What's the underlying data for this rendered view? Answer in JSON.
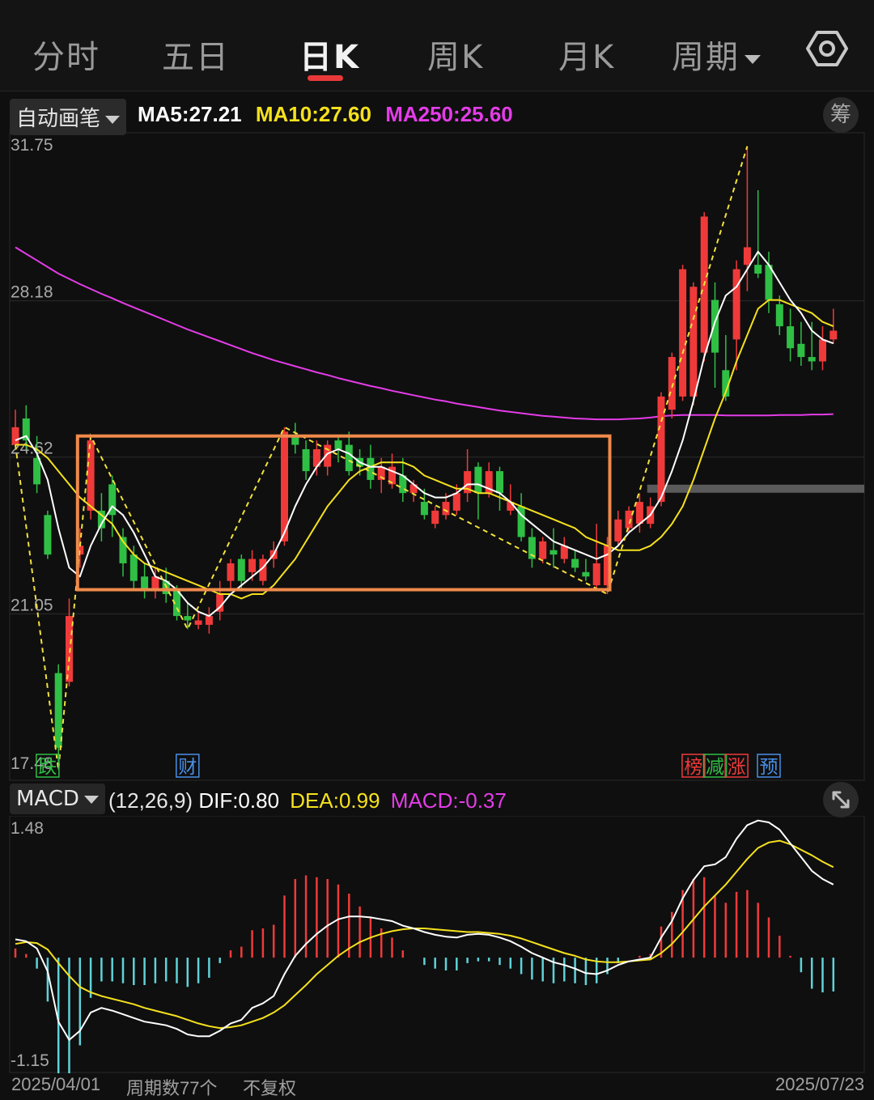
{
  "tabs": [
    {
      "label": "分时",
      "active": false
    },
    {
      "label": "五日",
      "active": false
    },
    {
      "label": "日K",
      "active": true
    },
    {
      "label": "周K",
      "active": false
    },
    {
      "label": "月K",
      "active": false
    },
    {
      "label": "周期",
      "active": false,
      "dropdown": true
    }
  ],
  "settings_icon": "gear-icon",
  "main_panel": {
    "drawing_mode": "自动画笔",
    "legend": [
      {
        "label": "MA5:",
        "value": "27.21",
        "color": "#ffffff"
      },
      {
        "label": "MA10:",
        "value": "27.60",
        "color": "#f5e11e"
      },
      {
        "label": "MA250:",
        "value": "25.60",
        "color": "#e43ce8"
      }
    ],
    "chip_button": "筹"
  },
  "macd_panel": {
    "indicator": "MACD",
    "params": "(12,26,9)",
    "legend": [
      {
        "label": "DIF:",
        "value": "0.80",
        "color": "#ffffff"
      },
      {
        "label": "DEA:",
        "value": "0.99",
        "color": "#f5e11e"
      },
      {
        "label": "MACD:",
        "value": "-0.37",
        "color": "#e43ce8"
      }
    ],
    "expand_icon": "expand-icon"
  },
  "footer": {
    "start_date": "2025/04/01",
    "period_count": "周期数77个",
    "adjust": "不复权",
    "end_date": "2025/07/23"
  },
  "colors": {
    "up": "#f03a3a",
    "down": "#2fbf45",
    "ma5": "#ffffff",
    "ma10": "#f5e11e",
    "ma250": "#e43ce8",
    "box": "#f08a4b",
    "pen": "#f2e23a",
    "macd_pos": "#f03a3a",
    "macd_neg": "#5fd3d9"
  },
  "chart_data": [
    {
      "type": "candlestick",
      "title": "",
      "y_ticks": [
        "31.75",
        "28.18",
        "24.62",
        "21.05",
        "17.48"
      ],
      "ylim": [
        17.48,
        31.75
      ],
      "num_periods": 77,
      "x_start": "2025/04/01",
      "x_end": "2025/07/23",
      "candles": [
        [
          24.9,
          25.3,
          25.7,
          24.9
        ],
        [
          25.5,
          25.0,
          25.8,
          24.8
        ],
        [
          24.6,
          24.0,
          25.1,
          23.8
        ],
        [
          23.3,
          22.4,
          23.4,
          22.3
        ],
        [
          19.7,
          18.0,
          19.9,
          17.5
        ],
        [
          19.5,
          21.0,
          21.4,
          19.4
        ],
        [
          22.4,
          22.6,
          23.0,
          22.1
        ],
        [
          23.4,
          25.0,
          25.1,
          23.2
        ],
        [
          23.4,
          23.0,
          23.8,
          22.7
        ],
        [
          24.0,
          23.3,
          24.2,
          22.8
        ],
        [
          22.8,
          22.2,
          23.0,
          21.9
        ],
        [
          22.4,
          21.8,
          22.6,
          21.6
        ],
        [
          21.9,
          21.6,
          22.2,
          21.4
        ],
        [
          21.6,
          21.9,
          22.1,
          21.4
        ],
        [
          21.8,
          21.5,
          22.1,
          21.3
        ],
        [
          21.6,
          21.0,
          21.7,
          20.9
        ],
        [
          21.0,
          20.9,
          21.3,
          20.7
        ],
        [
          20.8,
          20.9,
          21.1,
          20.7
        ],
        [
          20.8,
          21.0,
          21.2,
          20.6
        ],
        [
          21.1,
          21.5,
          21.8,
          20.9
        ],
        [
          21.8,
          22.2,
          22.3,
          21.6
        ],
        [
          22.3,
          21.8,
          22.4,
          21.6
        ],
        [
          22.0,
          22.3,
          22.5,
          21.8
        ],
        [
          21.8,
          22.3,
          22.4,
          21.7
        ],
        [
          22.3,
          22.5,
          22.7,
          22.1
        ],
        [
          22.7,
          25.2,
          25.3,
          22.6
        ],
        [
          25.1,
          24.9,
          25.4,
          24.7
        ],
        [
          24.8,
          24.3,
          25.0,
          24.1
        ],
        [
          24.4,
          24.8,
          25.0,
          24.2
        ],
        [
          24.4,
          24.9,
          25.0,
          24.2
        ],
        [
          25.0,
          24.8,
          25.1,
          24.5
        ],
        [
          24.9,
          24.3,
          25.2,
          24.2
        ],
        [
          24.6,
          24.4,
          24.8,
          24.2
        ],
        [
          24.6,
          24.1,
          24.9,
          23.9
        ],
        [
          24.1,
          24.4,
          24.6,
          23.8
        ],
        [
          24.0,
          24.4,
          24.7,
          23.9
        ],
        [
          24.2,
          23.8,
          24.6,
          23.6
        ],
        [
          23.8,
          24.0,
          24.1,
          23.6
        ],
        [
          23.6,
          23.3,
          23.9,
          23.2
        ],
        [
          23.1,
          23.4,
          23.5,
          23.0
        ],
        [
          23.3,
          23.6,
          23.8,
          23.2
        ],
        [
          23.4,
          23.8,
          24.0,
          23.3
        ],
        [
          23.8,
          24.3,
          24.8,
          23.6
        ],
        [
          24.4,
          23.8,
          24.5,
          23.2
        ],
        [
          23.8,
          24.3,
          24.5,
          23.7
        ],
        [
          24.3,
          23.8,
          24.4,
          23.4
        ],
        [
          23.4,
          23.6,
          24.0,
          23.3
        ],
        [
          23.5,
          22.8,
          23.8,
          22.7
        ],
        [
          22.8,
          22.3,
          23.0,
          22.1
        ],
        [
          22.3,
          22.7,
          22.8,
          22.2
        ],
        [
          22.5,
          22.4,
          23.0,
          22.1
        ],
        [
          22.3,
          22.6,
          22.8,
          22.2
        ],
        [
          22.3,
          22.1,
          22.5,
          22.0
        ],
        [
          22.0,
          21.9,
          22.3,
          21.8
        ],
        [
          21.7,
          22.2,
          23.1,
          21.6
        ],
        [
          21.7,
          22.6,
          22.8,
          21.5
        ],
        [
          22.7,
          23.2,
          23.4,
          22.6
        ],
        [
          23.0,
          23.4,
          23.5,
          22.9
        ],
        [
          23.1,
          23.6,
          23.8,
          22.9
        ],
        [
          23.1,
          23.5,
          23.7,
          23.0
        ],
        [
          23.6,
          26.0,
          26.1,
          23.5
        ],
        [
          25.7,
          26.9,
          27.0,
          25.5
        ],
        [
          26.0,
          28.9,
          29.0,
          25.9
        ],
        [
          26.0,
          28.5,
          28.6,
          25.8
        ],
        [
          27.0,
          30.1,
          30.2,
          26.8
        ],
        [
          28.2,
          27.0,
          28.6,
          26.2
        ],
        [
          26.6,
          26.0,
          27.4,
          25.9
        ],
        [
          27.3,
          28.9,
          29.1,
          26.6
        ],
        [
          29.0,
          29.4,
          31.7,
          28.4
        ],
        [
          29.0,
          28.8,
          30.7,
          28.7
        ],
        [
          29.0,
          28.2,
          29.3,
          27.9
        ],
        [
          28.1,
          27.6,
          28.3,
          27.4
        ],
        [
          27.6,
          27.1,
          28.0,
          26.8
        ],
        [
          27.2,
          26.9,
          27.7,
          26.7
        ],
        [
          26.9,
          26.8,
          27.7,
          26.6
        ],
        [
          26.8,
          27.3,
          27.6,
          26.6
        ],
        [
          27.3,
          27.5,
          28.0,
          27.2
        ]
      ],
      "ma5": [
        25.0,
        25.1,
        24.7,
        24.1,
        23.0,
        22.1,
        21.9,
        22.6,
        23.1,
        23.5,
        23.3,
        22.9,
        22.4,
        21.9,
        21.8,
        21.6,
        21.3,
        21.1,
        21.0,
        21.2,
        21.5,
        21.7,
        21.9,
        22.1,
        22.4,
        22.9,
        23.5,
        24.0,
        24.4,
        24.7,
        24.8,
        24.7,
        24.5,
        24.4,
        24.4,
        24.3,
        24.2,
        24.0,
        23.8,
        23.7,
        23.7,
        23.8,
        24.0,
        24.0,
        23.9,
        23.8,
        23.6,
        23.3,
        23.1,
        22.9,
        22.7,
        22.6,
        22.5,
        22.4,
        22.3,
        22.4,
        22.6,
        22.9,
        23.1,
        23.3,
        23.7,
        24.3,
        25.0,
        25.9,
        26.9,
        27.7,
        28.3,
        28.5,
        28.9,
        29.3,
        29.0,
        28.6,
        28.2,
        27.9,
        27.5,
        27.3,
        27.21
      ],
      "ma10": [
        24.9,
        24.9,
        24.8,
        24.6,
        24.3,
        24.0,
        23.7,
        23.5,
        23.3,
        23.1,
        22.7,
        22.4,
        22.2,
        22.1,
        22.0,
        21.9,
        21.8,
        21.7,
        21.6,
        21.5,
        21.5,
        21.4,
        21.5,
        21.5,
        21.7,
        22.0,
        22.3,
        22.7,
        23.1,
        23.5,
        23.8,
        24.1,
        24.3,
        24.4,
        24.5,
        24.5,
        24.5,
        24.4,
        24.2,
        24.1,
        24.0,
        23.9,
        23.9,
        23.8,
        23.8,
        23.7,
        23.6,
        23.5,
        23.4,
        23.3,
        23.2,
        23.1,
        23.0,
        22.8,
        22.7,
        22.6,
        22.5,
        22.5,
        22.5,
        22.6,
        22.8,
        23.1,
        23.5,
        24.1,
        24.8,
        25.5,
        26.1,
        26.8,
        27.4,
        28.0,
        28.2,
        28.2,
        28.1,
        28.0,
        27.9,
        27.7,
        27.6
      ],
      "ma250": [
        29.4,
        29.25,
        29.1,
        28.95,
        28.8,
        28.68,
        28.56,
        28.45,
        28.34,
        28.24,
        28.13,
        28.03,
        27.93,
        27.83,
        27.73,
        27.63,
        27.53,
        27.44,
        27.35,
        27.26,
        27.17,
        27.08,
        26.99,
        26.91,
        26.83,
        26.76,
        26.69,
        26.62,
        26.55,
        26.49,
        26.42,
        26.36,
        26.3,
        26.24,
        26.19,
        26.13,
        26.08,
        26.03,
        25.98,
        25.93,
        25.89,
        25.84,
        25.8,
        25.76,
        25.72,
        25.68,
        25.65,
        25.62,
        25.59,
        25.56,
        25.54,
        25.52,
        25.5,
        25.49,
        25.48,
        25.48,
        25.48,
        25.49,
        25.5,
        25.52,
        25.55,
        25.57,
        25.58,
        25.58,
        25.58,
        25.58,
        25.57,
        25.57,
        25.57,
        25.57,
        25.57,
        25.58,
        25.58,
        25.58,
        25.59,
        25.59,
        25.6
      ],
      "pens": [
        [
          0,
          24.9
        ],
        [
          4,
          17.5
        ],
        [
          7,
          25.1
        ],
        [
          16,
          20.7
        ],
        [
          25,
          25.3
        ],
        [
          55,
          21.5
        ],
        [
          68,
          31.7
        ]
      ],
      "box": {
        "from_index": 6,
        "to_index": 55,
        "top": 25.1,
        "bottom": 21.6
      },
      "support_line": {
        "value": 23.9,
        "from_index": 59
      },
      "markers": [
        {
          "index": 3,
          "label": "跌",
          "kind": "down"
        },
        {
          "index": 16,
          "label": "财",
          "kind": "news"
        },
        {
          "index": 63,
          "label": "榜",
          "kind": "up"
        },
        {
          "index": 65,
          "label": "减",
          "kind": "down"
        },
        {
          "index": 67,
          "label": "涨",
          "kind": "up"
        },
        {
          "index": 70,
          "label": "预",
          "kind": "news"
        }
      ]
    },
    {
      "type": "bar",
      "title": "",
      "y_ticks": [
        "1.48",
        "-1.15"
      ],
      "ylim": [
        -1.15,
        1.48
      ],
      "dif": [
        0.2,
        0.18,
        0.1,
        -0.15,
        -0.7,
        -0.9,
        -0.8,
        -0.6,
        -0.55,
        -0.58,
        -0.62,
        -0.66,
        -0.7,
        -0.72,
        -0.74,
        -0.78,
        -0.84,
        -0.86,
        -0.86,
        -0.8,
        -0.72,
        -0.68,
        -0.55,
        -0.5,
        -0.42,
        -0.18,
        0.02,
        0.15,
        0.26,
        0.35,
        0.42,
        0.45,
        0.45,
        0.44,
        0.42,
        0.4,
        0.35,
        0.32,
        0.28,
        0.25,
        0.23,
        0.22,
        0.25,
        0.26,
        0.25,
        0.22,
        0.18,
        0.12,
        0.05,
        0.0,
        -0.05,
        -0.08,
        -0.12,
        -0.17,
        -0.18,
        -0.14,
        -0.08,
        -0.04,
        -0.02,
        0.0,
        0.22,
        0.4,
        0.65,
        0.85,
        1.0,
        1.02,
        1.1,
        1.3,
        1.45,
        1.5,
        1.48,
        1.4,
        1.25,
        1.1,
        0.95,
        0.86,
        0.8
      ],
      "dea": [
        0.15,
        0.17,
        0.16,
        0.09,
        -0.06,
        -0.2,
        -0.32,
        -0.38,
        -0.42,
        -0.45,
        -0.48,
        -0.51,
        -0.55,
        -0.58,
        -0.61,
        -0.64,
        -0.68,
        -0.72,
        -0.75,
        -0.77,
        -0.76,
        -0.74,
        -0.7,
        -0.66,
        -0.6,
        -0.52,
        -0.41,
        -0.3,
        -0.18,
        -0.08,
        0.02,
        0.1,
        0.17,
        0.22,
        0.26,
        0.29,
        0.31,
        0.32,
        0.32,
        0.31,
        0.3,
        0.29,
        0.28,
        0.28,
        0.27,
        0.26,
        0.24,
        0.21,
        0.17,
        0.13,
        0.09,
        0.05,
        0.02,
        -0.02,
        -0.04,
        -0.05,
        -0.05,
        -0.04,
        -0.03,
        -0.02,
        0.05,
        0.15,
        0.28,
        0.42,
        0.56,
        0.68,
        0.8,
        0.94,
        1.08,
        1.2,
        1.26,
        1.28,
        1.24,
        1.18,
        1.12,
        1.05,
        0.99
      ],
      "macd": [
        0.1,
        0.04,
        -0.12,
        -0.48,
        -1.28,
        -1.4,
        -0.96,
        -0.44,
        -0.26,
        -0.26,
        -0.28,
        -0.3,
        -0.3,
        -0.28,
        -0.26,
        -0.28,
        -0.32,
        -0.28,
        -0.22,
        -0.06,
        0.08,
        0.12,
        0.3,
        0.32,
        0.36,
        0.68,
        0.86,
        0.9,
        0.88,
        0.86,
        0.8,
        0.7,
        0.56,
        0.44,
        0.32,
        0.22,
        0.08,
        0.0,
        -0.08,
        -0.12,
        -0.14,
        -0.14,
        -0.06,
        -0.04,
        -0.04,
        -0.08,
        -0.12,
        -0.18,
        -0.24,
        -0.26,
        -0.28,
        -0.26,
        -0.28,
        -0.3,
        -0.28,
        -0.18,
        -0.06,
        0.0,
        0.02,
        0.04,
        0.34,
        0.5,
        0.74,
        0.86,
        0.88,
        0.68,
        0.6,
        0.72,
        0.74,
        0.6,
        0.44,
        0.24,
        0.02,
        -0.16,
        -0.34,
        -0.38,
        -0.37
      ]
    }
  ]
}
